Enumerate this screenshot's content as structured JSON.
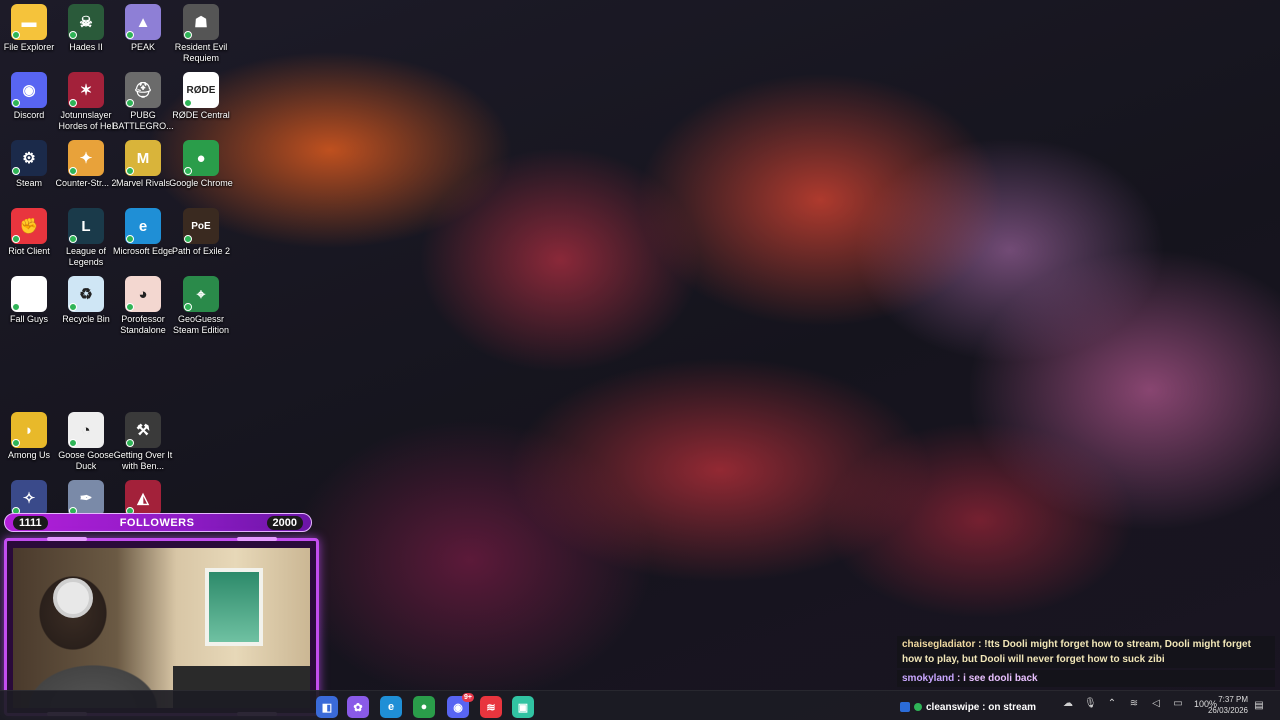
{
  "desktop": {
    "icons": [
      {
        "label": "File Explorer",
        "icon": "folder-icon",
        "color": "#f5c33b",
        "glyph": "▬"
      },
      {
        "label": "Hades II",
        "icon": "hades-icon",
        "color": "#2a5a3a",
        "glyph": "☠"
      },
      {
        "label": "PEAK",
        "icon": "peak-icon",
        "color": "#8e7fd6",
        "glyph": "▲"
      },
      {
        "label": "Resident Evil Requiem",
        "icon": "resident-evil-icon",
        "color": "#555555",
        "glyph": "☗"
      },
      {
        "label": "Discord",
        "icon": "discord-icon",
        "color": "#5865f2",
        "glyph": "◉"
      },
      {
        "label": "Jotunnslayer Hordes of Hel",
        "icon": "jotunnslayer-icon",
        "color": "#a3213a",
        "glyph": "✶"
      },
      {
        "label": "PUBG BATTLEGRO...",
        "icon": "pubg-icon",
        "color": "#6b6b6b",
        "glyph": "⛑"
      },
      {
        "label": "RØDE Central",
        "icon": "rode-icon",
        "color": "#ffffff",
        "glyph": "RØDE"
      },
      {
        "label": "Steam",
        "icon": "steam-icon",
        "color": "#1b2a4a",
        "glyph": "⚙"
      },
      {
        "label": "Counter-Str... 2",
        "icon": "counter-strike-icon",
        "color": "#e8a23a",
        "glyph": "✦"
      },
      {
        "label": "Marvel Rivals",
        "icon": "marvel-rivals-icon",
        "color": "#d9b43a",
        "glyph": "M"
      },
      {
        "label": "Google Chrome",
        "icon": "chrome-icon",
        "color": "#2a9d4a",
        "glyph": "●"
      },
      {
        "label": "Riot Client",
        "icon": "riot-client-icon",
        "color": "#e8353e",
        "glyph": "✊"
      },
      {
        "label": "League of Legends",
        "icon": "league-of-legends-icon",
        "color": "#1a3a4a",
        "glyph": "L"
      },
      {
        "label": "Microsoft Edge",
        "icon": "edge-icon",
        "color": "#1f8fd6",
        "glyph": "e"
      },
      {
        "label": "Path of Exile 2",
        "icon": "path-of-exile-icon",
        "color": "#3a2a20",
        "glyph": "PoE"
      },
      {
        "label": "Fall Guys",
        "icon": "fall-guys-icon",
        "color": "#ffffff",
        "glyph": ""
      },
      {
        "label": "Recycle Bin",
        "icon": "recycle-bin-icon",
        "color": "#cfe6f5",
        "glyph": "♻"
      },
      {
        "label": "Porofessor Standalone",
        "icon": "porofessor-icon",
        "color": "#f3d7d0",
        "glyph": "◕"
      },
      {
        "label": "GeoGuessr Steam Edition",
        "icon": "geoguessr-icon",
        "color": "#2a8a4a",
        "glyph": "⌖"
      },
      {
        "label": "Among Us",
        "icon": "among-us-icon",
        "color": "#e8b92a",
        "glyph": "◗"
      },
      {
        "label": "Goose Goose Duck",
        "icon": "goose-goose-duck-icon",
        "color": "#eeeeee",
        "glyph": "◔"
      },
      {
        "label": "Getting Over It with Ben...",
        "icon": "getting-over-it-icon",
        "color": "#3a3a3a",
        "glyph": "⚒"
      },
      {
        "label": "",
        "icon": "vampire-survivors-icon",
        "color": "#3a4a8a",
        "glyph": "✧"
      },
      {
        "label": "",
        "icon": "quill-icon",
        "color": "#7a8aa8",
        "glyph": "✒"
      },
      {
        "label": "",
        "icon": "hooded-figure-icon",
        "color": "#a3213a",
        "glyph": "◭"
      }
    ]
  },
  "followers": {
    "current": "1111",
    "label": "FOLLOWERS",
    "goal": "2000"
  },
  "chat": {
    "messages": [
      {
        "user": "chaisegladiator",
        "text": " : !tts Dooli might forget how to stream, Dooli might forget how to play, but Dooli will never forget how to suck zibi"
      },
      {
        "user": "smokyland",
        "text": " : i see dooli back"
      }
    ]
  },
  "taskbar": {
    "apps": [
      {
        "name": "taskbar-app-generic",
        "color": "#3a6ad8",
        "glyph": "◧"
      },
      {
        "name": "taskbar-copilot",
        "color": "#8a5ae8",
        "glyph": "✿"
      },
      {
        "name": "taskbar-edge",
        "color": "#1f8fd6",
        "glyph": "e"
      },
      {
        "name": "taskbar-chrome",
        "color": "#2a9d4a",
        "glyph": "●"
      },
      {
        "name": "taskbar-discord",
        "color": "#5865f2",
        "glyph": "◉",
        "badge": "9+"
      },
      {
        "name": "taskbar-red-app",
        "color": "#e8353e",
        "glyph": "≋"
      },
      {
        "name": "taskbar-streamlabs",
        "color": "#31c3a2",
        "glyph": "▣"
      }
    ],
    "stream_status": "cleanswipe : on stream",
    "tray": {
      "battery": "100%"
    },
    "clock": {
      "time": "7:37 PM",
      "date": "26/03/2026"
    }
  }
}
